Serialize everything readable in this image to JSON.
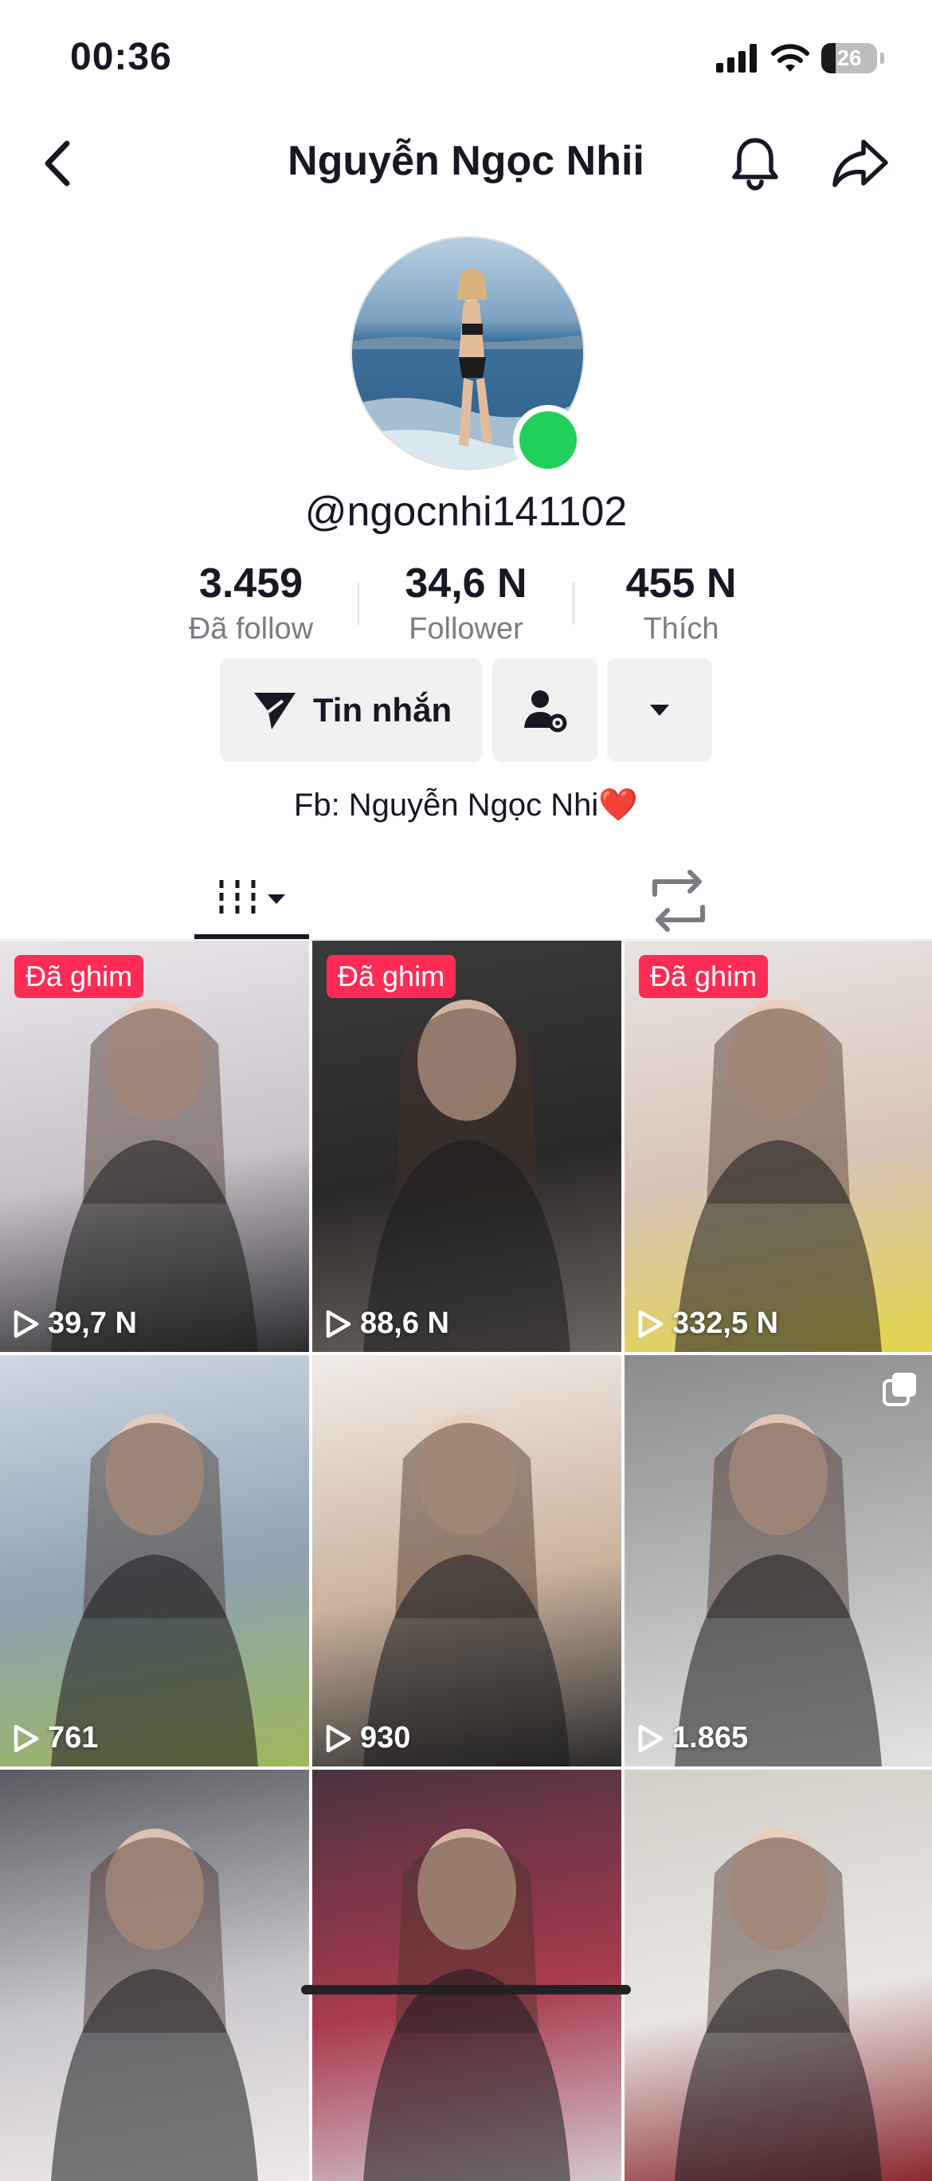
{
  "status": {
    "time": "00:36",
    "battery": "26"
  },
  "header": {
    "title": "Nguyễn Ngọc Nhii"
  },
  "profile": {
    "username": "@ngocnhi141102",
    "bio": "Fb: Nguyễn Ngọc Nhi❤️"
  },
  "stats": [
    {
      "value": "3.459",
      "label": "Đã follow"
    },
    {
      "value": "34,6 N",
      "label": "Follower"
    },
    {
      "value": "455 N",
      "label": "Thích"
    }
  ],
  "actions": {
    "message_label": "Tin nhắn"
  },
  "videos": [
    {
      "pinned": "Đã ghim",
      "views": "39,7 N",
      "colors": [
        "#e9e6ea",
        "#c9c2c8",
        "#2b2b2e"
      ]
    },
    {
      "pinned": "Đã ghim",
      "views": "88,6 N",
      "colors": [
        "#3b3a3a",
        "#2a2828",
        "#6c6560"
      ]
    },
    {
      "pinned": "Đã ghim",
      "views": "332,5 N",
      "colors": [
        "#e8e4e2",
        "#d8c4b8",
        "#e3d54a"
      ]
    },
    {
      "pinned": "",
      "views": "761",
      "colors": [
        "#cfd8e2",
        "#8da1b2",
        "#9fb85a"
      ]
    },
    {
      "pinned": "",
      "views": "930",
      "colors": [
        "#f2ece8",
        "#cbb39e",
        "#2a2a2a"
      ]
    },
    {
      "pinned": "",
      "views": "1.865",
      "colors": [
        "#8c8c8c",
        "#b9b9b9",
        "#e3e3e3"
      ]
    },
    {
      "pinned": "",
      "views": "",
      "colors": [
        "#5a5a62",
        "#c9c6cc",
        "#eeeaea"
      ]
    },
    {
      "pinned": "",
      "views": "",
      "colors": [
        "#4a3340",
        "#a93a4e",
        "#d3c8cf"
      ]
    },
    {
      "pinned": "",
      "views": "",
      "colors": [
        "#d2cfc8",
        "#e9e6e2",
        "#8a2a30"
      ]
    }
  ]
}
